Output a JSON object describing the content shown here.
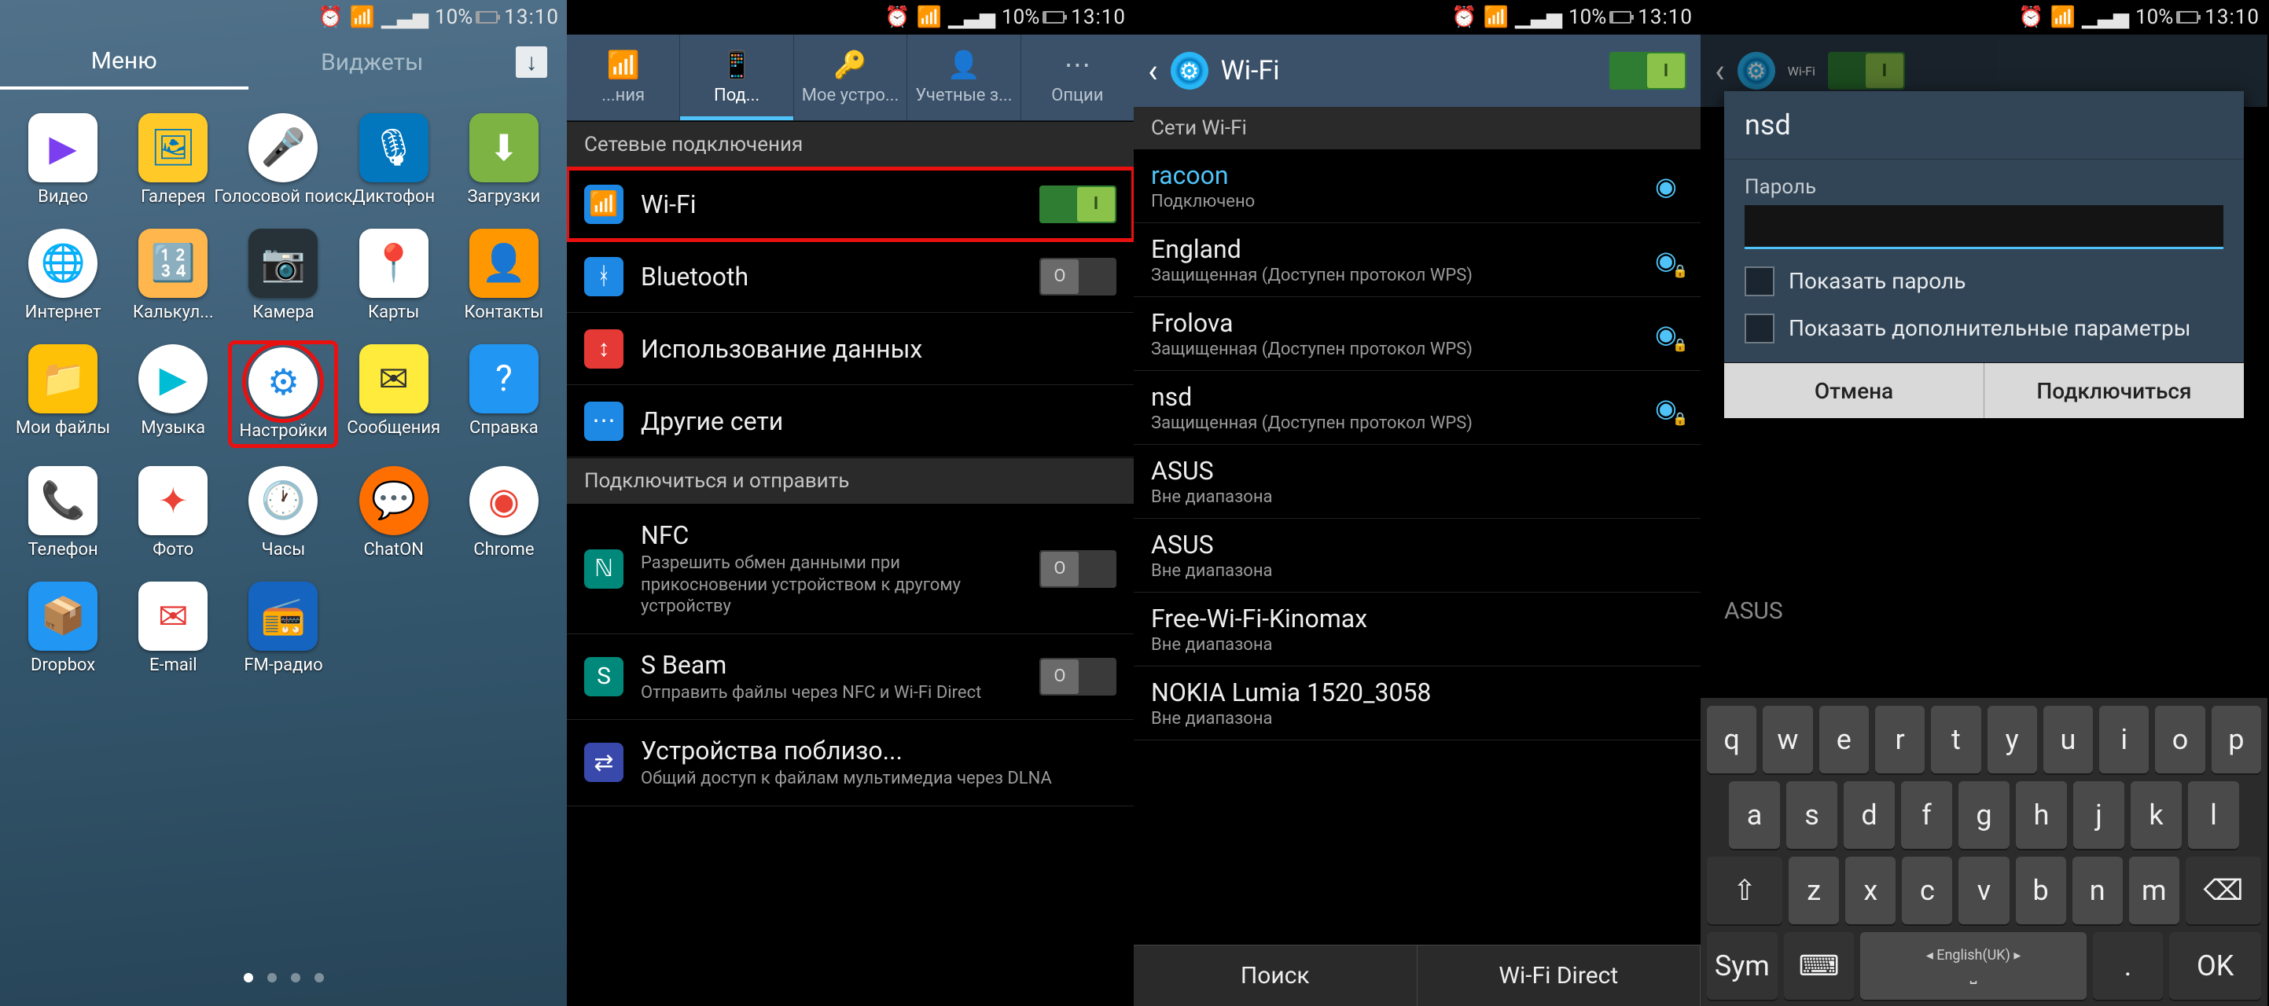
{
  "status": {
    "battery": "10%",
    "time": "13:10"
  },
  "p1": {
    "tabs": {
      "menu": "Меню",
      "widgets": "Виджеты"
    },
    "apps": [
      {
        "label": "Видео",
        "bg": "#fff",
        "fg": "#7b3ff0",
        "glyph": "▶"
      },
      {
        "label": "Галерея",
        "bg": "#ffca28",
        "fg": "#0277bd",
        "glyph": "🖼"
      },
      {
        "label": "Голосовой поиск",
        "bg": "#fff",
        "fg": "#e53935",
        "glyph": "🎤",
        "round": true
      },
      {
        "label": "Диктофон",
        "bg": "#0277bd",
        "fg": "#fff",
        "glyph": "🎙"
      },
      {
        "label": "Загрузки",
        "bg": "#7cb342",
        "fg": "#fff",
        "glyph": "⬇"
      },
      {
        "label": "Интернет",
        "bg": "#fff",
        "fg": "#1976d2",
        "glyph": "🌐",
        "round": true
      },
      {
        "label": "Калькул...",
        "bg": "#ffb74d",
        "fg": "#333",
        "glyph": "🔢"
      },
      {
        "label": "Камера",
        "bg": "#263238",
        "fg": "#fff",
        "glyph": "📷"
      },
      {
        "label": "Карты",
        "bg": "#fff",
        "fg": "#34a853",
        "glyph": "📍"
      },
      {
        "label": "Контакты",
        "bg": "#ff9800",
        "fg": "#fff",
        "glyph": "👤"
      },
      {
        "label": "Мои файлы",
        "bg": "#ffc107",
        "fg": "#795548",
        "glyph": "📁"
      },
      {
        "label": "Музыка",
        "bg": "#fff",
        "fg": "#00bcd4",
        "glyph": "▶",
        "round": true
      },
      {
        "label": "Настройки",
        "bg": "#fff",
        "fg": "#1e88e5",
        "glyph": "⚙",
        "round": true,
        "hili": true
      },
      {
        "label": "Сообщения",
        "bg": "#ffeb3b",
        "fg": "#333",
        "glyph": "✉"
      },
      {
        "label": "Справка",
        "bg": "#2196f3",
        "fg": "#fff",
        "glyph": "?"
      },
      {
        "label": "Телефон",
        "bg": "#fff",
        "fg": "#4caf50",
        "glyph": "📞"
      },
      {
        "label": "Фото",
        "bg": "#fff",
        "fg": "#ea4335",
        "glyph": "✦"
      },
      {
        "label": "Часы",
        "bg": "#fff",
        "fg": "#333",
        "glyph": "🕐",
        "round": true
      },
      {
        "label": "ChatON",
        "bg": "#ff6f00",
        "fg": "#fff",
        "glyph": "💬",
        "round": true
      },
      {
        "label": "Chrome",
        "bg": "#fff",
        "fg": "#ea4335",
        "glyph": "◉",
        "round": true
      },
      {
        "label": "Dropbox",
        "bg": "#2196f3",
        "fg": "#fff",
        "glyph": "📦"
      },
      {
        "label": "E-mail",
        "bg": "#fff",
        "fg": "#e53935",
        "glyph": "✉"
      },
      {
        "label": "FM-радио",
        "bg": "#1565c0",
        "fg": "#fff",
        "glyph": "📻"
      }
    ]
  },
  "p2": {
    "tabs": [
      {
        "label": "...ния",
        "icon": "📶"
      },
      {
        "label": "Под...",
        "icon": "📱",
        "active": true
      },
      {
        "label": "Мое устро...",
        "icon": "🔑"
      },
      {
        "label": "Учетные з...",
        "icon": "👤"
      },
      {
        "label": "Опции",
        "icon": "⋯"
      }
    ],
    "sect1": "Сетевые подключения",
    "rows1": [
      {
        "icon": "📶",
        "iconbg": "#1e88e5",
        "title": "Wi-Fi",
        "toggle": "on",
        "hili": true
      },
      {
        "icon": "ᚼ",
        "iconbg": "#1e88e5",
        "title": "Bluetooth",
        "toggle": "off"
      },
      {
        "icon": "↕",
        "iconbg": "#e53935",
        "title": "Использование данных"
      },
      {
        "icon": "⋯",
        "iconbg": "#1e88e5",
        "title": "Другие сети"
      }
    ],
    "sect2": "Подключиться и отправить",
    "rows2": [
      {
        "icon": "ℕ",
        "iconbg": "#00897b",
        "title": "NFC",
        "sub": "Разрешить обмен данными при прикосновении устройством к другому устройству",
        "toggle": "off"
      },
      {
        "icon": "S",
        "iconbg": "#00897b",
        "title": "S Beam",
        "sub": "Отправить файлы через NFC и Wi-Fi Direct",
        "toggle": "off"
      },
      {
        "icon": "⇄",
        "iconbg": "#3949ab",
        "title": "Устройства поблизо...",
        "sub": "Общий доступ к файлам мультимедиа через DLNA"
      }
    ]
  },
  "p3": {
    "title": "Wi-Fi",
    "section": "Сети Wi-Fi",
    "nets": [
      {
        "name": "racoon",
        "status": "Подключено",
        "signal": true,
        "lock": false,
        "connected": true
      },
      {
        "name": "England",
        "status": "Защищенная (Доступен протокол WPS)",
        "signal": true,
        "lock": true
      },
      {
        "name": "Frolova",
        "status": "Защищенная (Доступен протокол WPS)",
        "signal": true,
        "lock": true
      },
      {
        "name": "nsd",
        "status": "Защищенная (Доступен протокол WPS)",
        "signal": true,
        "lock": true
      },
      {
        "name": "ASUS",
        "status": "Вне диапазона"
      },
      {
        "name": "ASUS",
        "status": "Вне диапазона"
      },
      {
        "name": "Free-Wi-Fi-Kinomax",
        "status": "Вне диапазона"
      },
      {
        "name": "NOKIA Lumia 1520_3058",
        "status": "Вне диапазона"
      }
    ],
    "btns": {
      "search": "Поиск",
      "direct": "Wi-Fi Direct"
    }
  },
  "p4": {
    "title": "Wi-Fi",
    "dialog": {
      "ssid": "nsd",
      "pw_label": "Пароль",
      "pw_value": "",
      "show_pw": "Показать пароль",
      "adv": "Показать дополнительные параметры",
      "cancel": "Отмена",
      "connect": "Подключиться"
    },
    "bg_asus": "ASUS",
    "kb": {
      "r1": [
        "q",
        "w",
        "e",
        "r",
        "t",
        "y",
        "u",
        "i",
        "o",
        "p"
      ],
      "r2": [
        "a",
        "s",
        "d",
        "f",
        "g",
        "h",
        "j",
        "k",
        "l"
      ],
      "shift": "⇧",
      "r3": [
        "z",
        "x",
        "c",
        "v",
        "b",
        "n",
        "m"
      ],
      "bksp": "⌫",
      "sym": "Sym",
      "kbswitch": "⌨",
      "space": "English(UK)",
      "dot": ".",
      "ok": "OK"
    }
  }
}
